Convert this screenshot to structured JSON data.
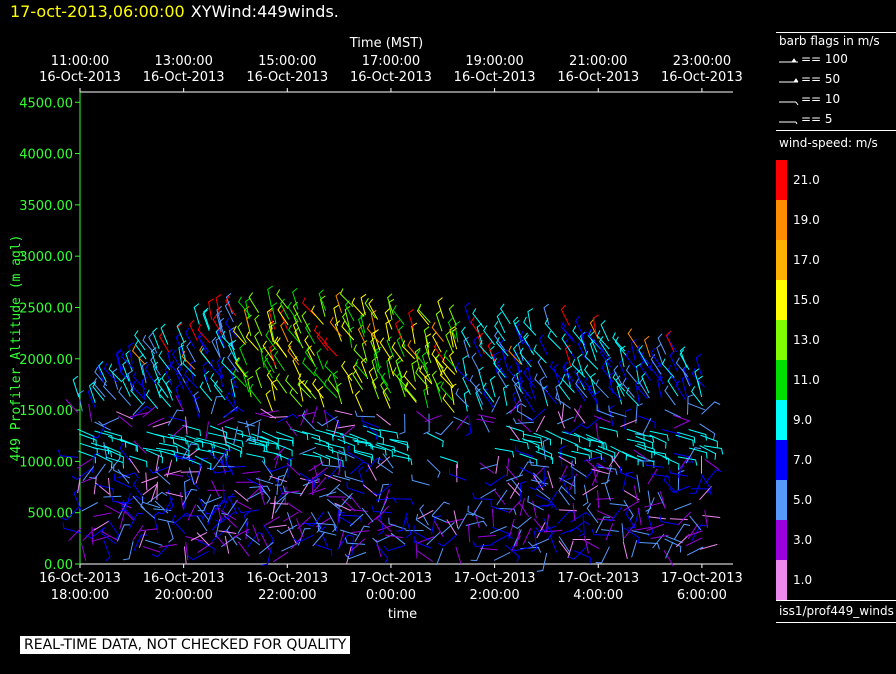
{
  "header": {
    "datetime": "17-oct-2013,06:00:00",
    "product": "XYWind:449winds."
  },
  "chart_data": {
    "type": "scatter",
    "title": "17-oct-2013,06:00:00  XYWind:449winds.",
    "top_axis": {
      "title": "Time (MST)",
      "ticks": [
        {
          "time": "11:00:00",
          "date": "16-Oct-2013"
        },
        {
          "time": "13:00:00",
          "date": "16-Oct-2013"
        },
        {
          "time": "15:00:00",
          "date": "16-Oct-2013"
        },
        {
          "time": "17:00:00",
          "date": "16-Oct-2013"
        },
        {
          "time": "19:00:00",
          "date": "16-Oct-2013"
        },
        {
          "time": "21:00:00",
          "date": "16-Oct-2013"
        },
        {
          "time": "23:00:00",
          "date": "16-Oct-2013"
        }
      ]
    },
    "bottom_axis": {
      "title": "time",
      "ticks": [
        {
          "date": "16-Oct-2013",
          "time": "18:00:00"
        },
        {
          "date": "16-Oct-2013",
          "time": "20:00:00"
        },
        {
          "date": "16-Oct-2013",
          "time": "22:00:00"
        },
        {
          "date": "17-Oct-2013",
          "time": "0:00:00"
        },
        {
          "date": "17-Oct-2013",
          "time": "2:00:00"
        },
        {
          "date": "17-Oct-2013",
          "time": "4:00:00"
        },
        {
          "date": "17-Oct-2013",
          "time": "6:00:00"
        }
      ],
      "xlim_hours_utc": [
        18,
        30.6
      ]
    },
    "y_axis": {
      "title": "449 Profiler Altitude (m agl)",
      "ticks": [
        "0.00",
        "500.00",
        "1000.00",
        "1500.00",
        "2000.00",
        "2500.00",
        "3000.00",
        "3500.00",
        "4000.00",
        "4500.00"
      ],
      "ylim": [
        0,
        4600
      ]
    },
    "wind_barbs": {
      "time_hours_utc_range": [
        18.0,
        30.2
      ],
      "time_step_hours": 0.25,
      "altitude_m_range": [
        150,
        2500
      ],
      "low_level_top_m": 1500,
      "upper_level_top_m_by_time": [
        [
          18,
          1700
        ],
        [
          19.5,
          2150
        ],
        [
          21,
          2500
        ],
        [
          23,
          2500
        ],
        [
          25,
          2350
        ],
        [
          27.5,
          2300
        ],
        [
          29.5,
          2100
        ],
        [
          30.2,
          1800
        ]
      ],
      "gap_region": {
        "time_hours_utc": [
          24.2,
          26.0
        ],
        "altitude_m": [
          500,
          1400
        ]
      },
      "shear_layer_m": 1200,
      "speed_notes": "low levels mostly 1-7 m/s; 11-15 m/s jet near 1600-2100 m between 21 and 25 UTC"
    },
    "legend": {
      "barb_title": "barb flags in m/s",
      "barbs": [
        "== 100",
        "== 50",
        "== 10",
        "== 5"
      ],
      "speed_title": "wind-speed: m/s",
      "speed_bins": [
        {
          "label": "21.0",
          "color": "#ff0000"
        },
        {
          "label": "19.0",
          "color": "#ff8c00"
        },
        {
          "label": "17.0",
          "color": "#ffb000"
        },
        {
          "label": "15.0",
          "color": "#ffff00"
        },
        {
          "label": "13.0",
          "color": "#7fff00"
        },
        {
          "label": "11.0",
          "color": "#00e000"
        },
        {
          "label": "9.0",
          "color": "#00ffff"
        },
        {
          "label": "7.0",
          "color": "#0000ff"
        },
        {
          "label": "5.0",
          "color": "#5599ff"
        },
        {
          "label": "3.0",
          "color": "#9900dd"
        },
        {
          "label": "1.0",
          "color": "#ee88ee"
        }
      ],
      "source": "iss1/prof449_winds"
    }
  },
  "footer": {
    "notice": "REAL-TIME DATA, NOT CHECKED FOR QUALITY"
  }
}
